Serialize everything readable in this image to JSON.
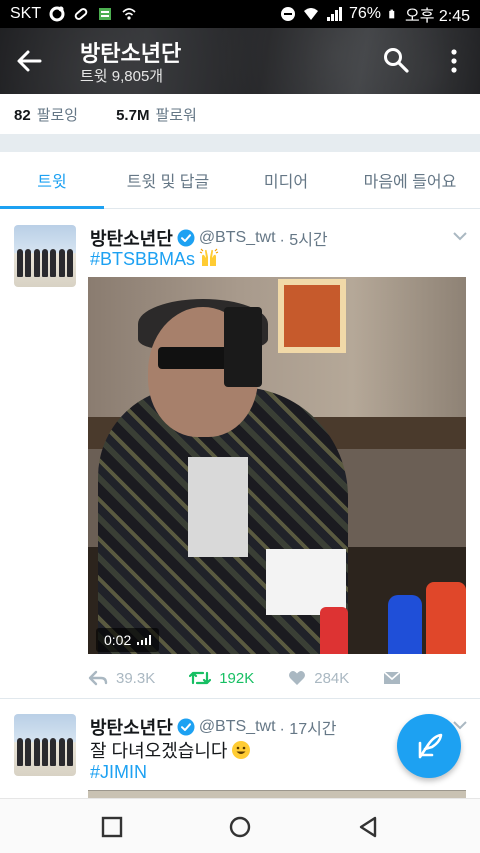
{
  "status_bar": {
    "carrier": "SKT",
    "battery": "76%",
    "time": "오후 2:45"
  },
  "header": {
    "title": "방탄소년단",
    "subtitle": "트윗 9,805개"
  },
  "stats": {
    "following_count": "82",
    "following_label": "팔로잉",
    "followers_count": "5.7M",
    "followers_label": "팔로워"
  },
  "tabs": [
    {
      "label": "트윗",
      "active": true
    },
    {
      "label": "트윗 및 답글",
      "active": false
    },
    {
      "label": "미디어",
      "active": false
    },
    {
      "label": "마음에 들어요",
      "active": false
    }
  ],
  "tweets": [
    {
      "name": "방탄소년단",
      "handle": "@BTS_twt",
      "time": "· 5시간",
      "lines": [
        "#BTSBBMAs"
      ],
      "video_duration": "0:02",
      "replies": "39.3K",
      "retweets": "192K",
      "likes": "284K"
    },
    {
      "name": "방탄소년단",
      "handle": "@BTS_twt",
      "time": "· 17시간",
      "lines": [
        "잘 다녀오겠습니다",
        "#JIMIN"
      ]
    }
  ],
  "icons": {
    "accent": "#1da1f2",
    "retweet_active": "#17bf63"
  }
}
